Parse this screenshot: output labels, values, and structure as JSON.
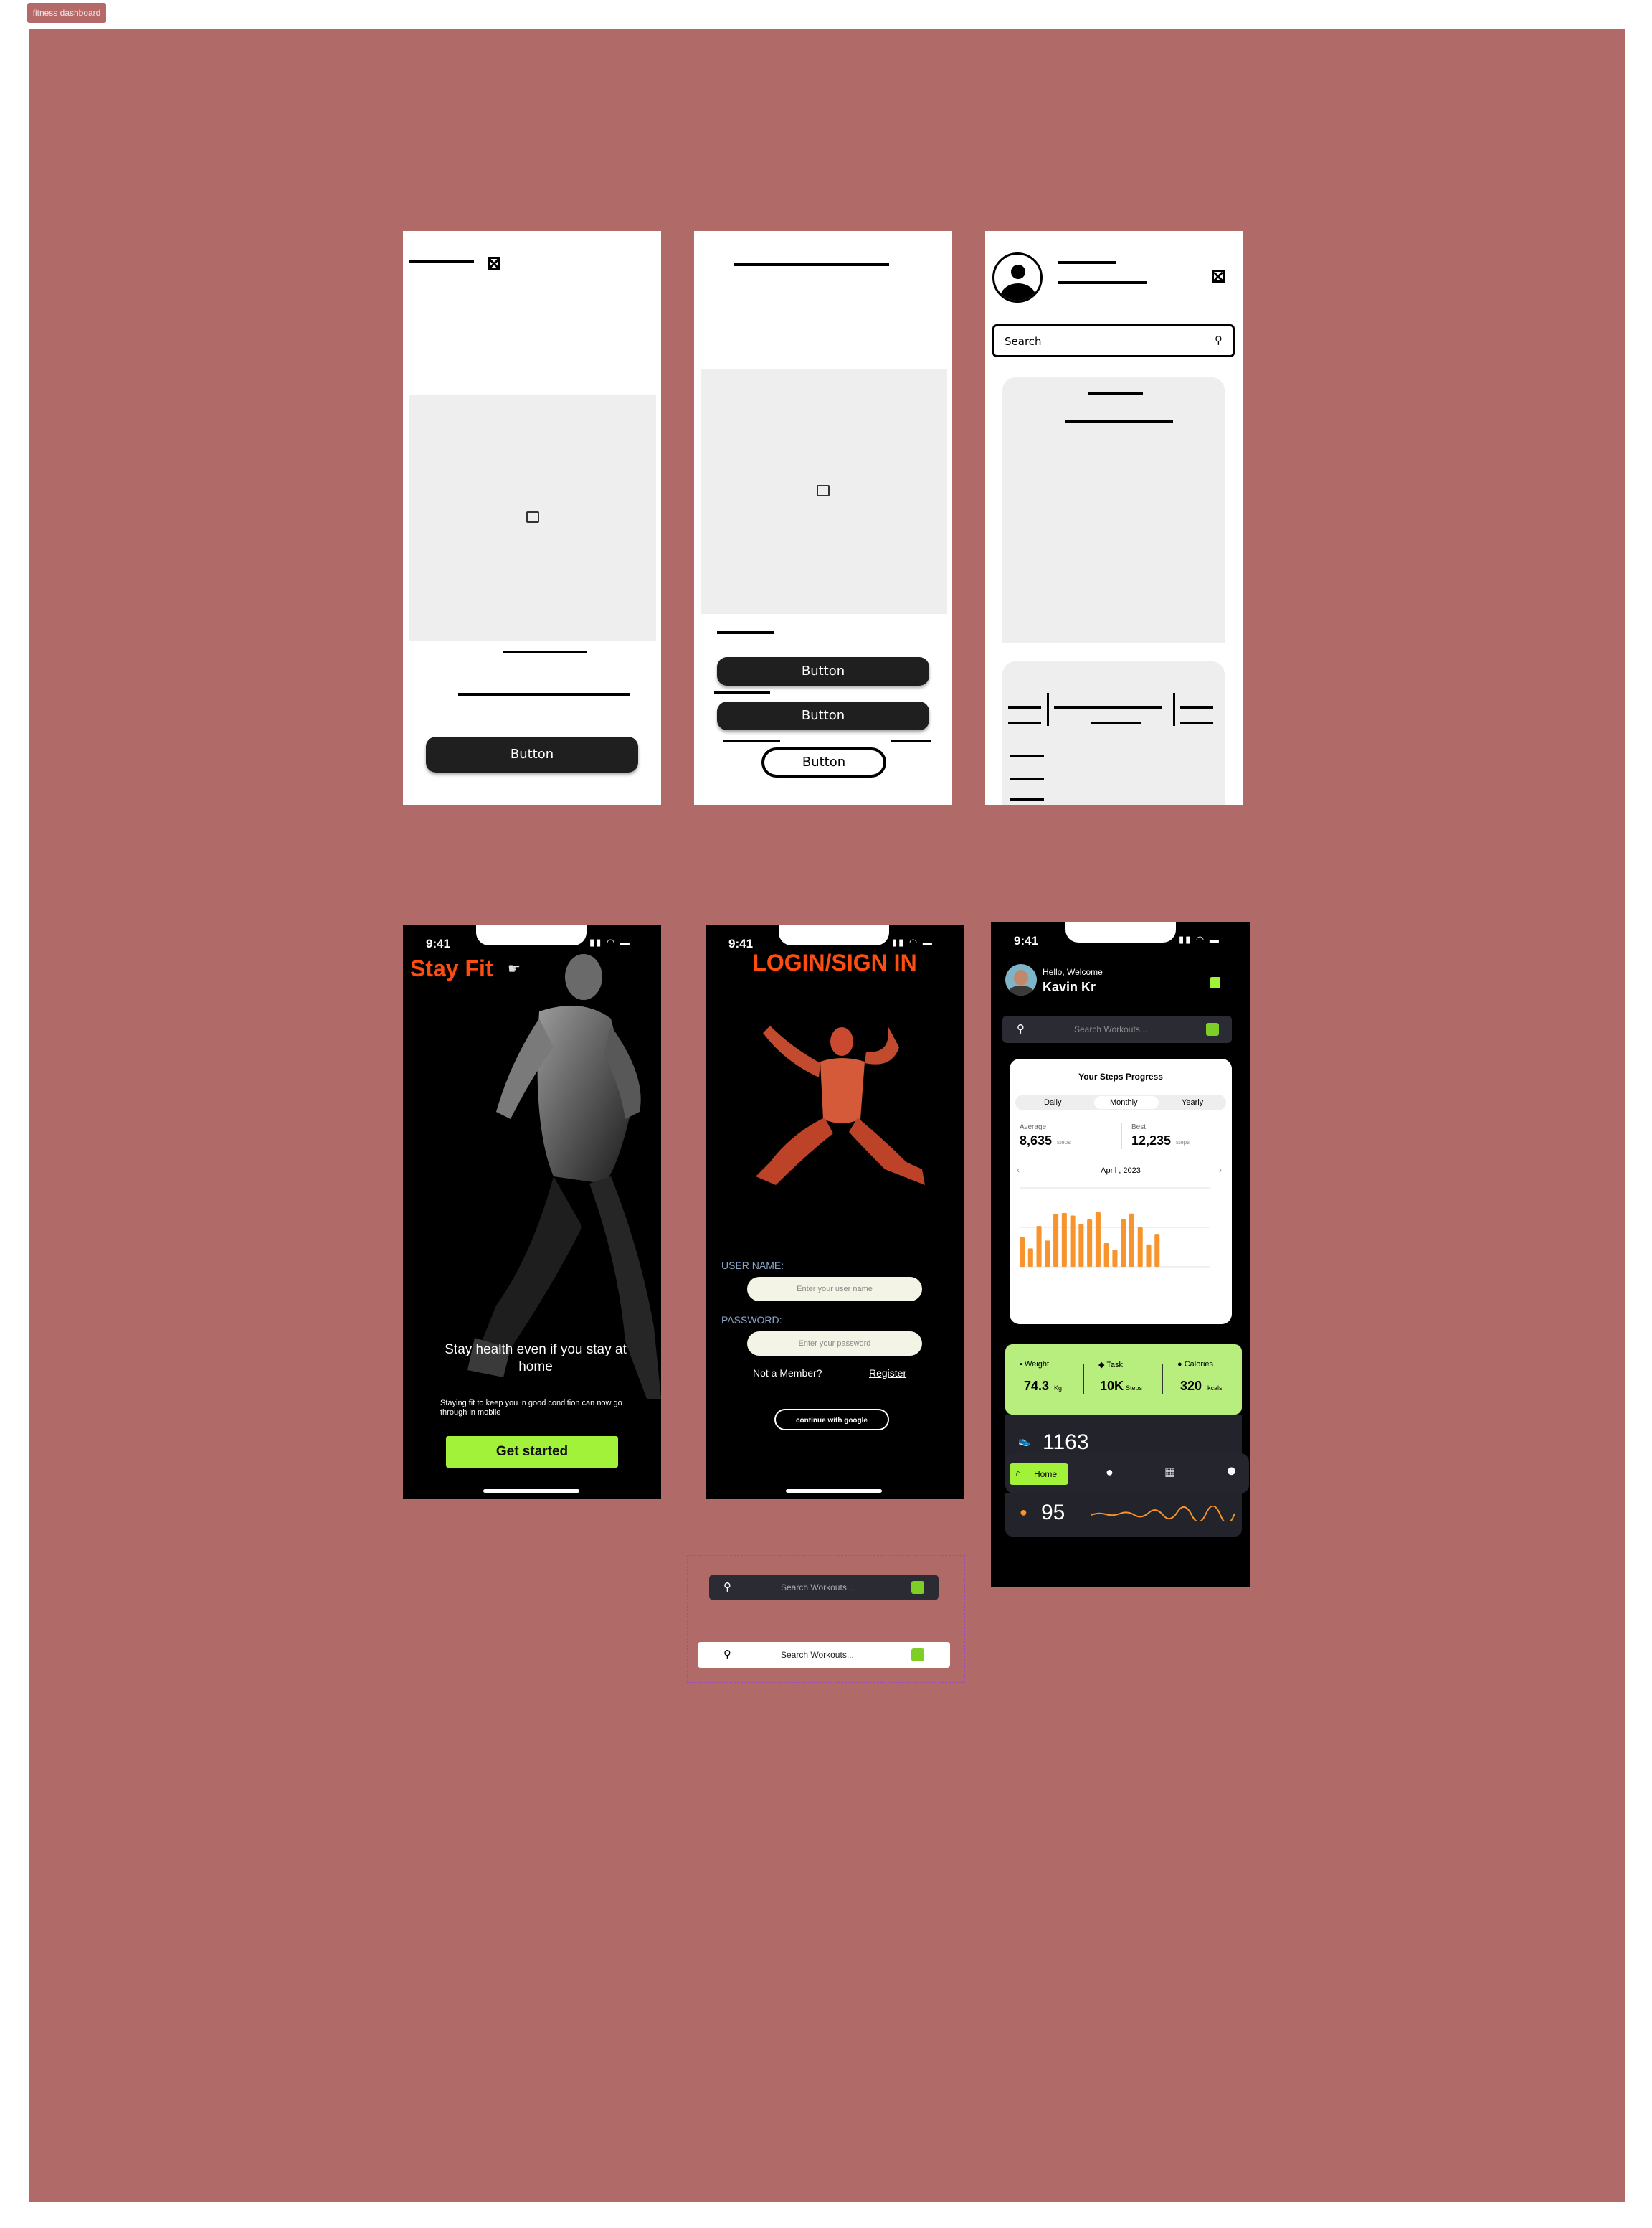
{
  "frame": {
    "label": "fitness dashboard"
  },
  "wireframes": {
    "screen1": {
      "button": "Button"
    },
    "screen2": {
      "buttons": [
        "Button",
        "Button",
        "Button"
      ]
    },
    "screen3": {
      "search": "Search"
    }
  },
  "status": {
    "time": "9:41"
  },
  "onboarding": {
    "title": "Stay Fit",
    "headline": "Stay health even if you stay at home",
    "body": "Staying fit to keep you in good condition can now go through in  mobile",
    "cta": "Get started"
  },
  "login": {
    "title": "LOGIN/SIGN IN",
    "user_label": "USER NAME:",
    "user_placeholder": "Enter your user name",
    "pass_label": "PASSWORD:",
    "pass_placeholder": "Enter your password",
    "not_member": "Not a Member?",
    "register": "Register",
    "google": "continue with google"
  },
  "dashboard": {
    "greeting": "Hello, Welcome",
    "user": "Kavin Kr",
    "search": "Search Workouts...",
    "card_title": "Your Steps Progress",
    "tabs": [
      "Daily",
      "Monthly",
      "Yearly"
    ],
    "average_label": "Average",
    "average_value": "8,635",
    "average_unit": "steps",
    "best_label": "Best",
    "best_value": "12,235",
    "best_unit": "steps",
    "month": "April , 2023",
    "stats": {
      "weight_label": "Weight",
      "weight_value": "74.3",
      "weight_unit": "Kg",
      "task_label": "Task",
      "task_value": "10K",
      "task_unit": "Steps",
      "cal_label": "Calories",
      "cal_value": "320",
      "cal_unit": "kcals"
    },
    "count1": "1163",
    "count2": "95",
    "nav_home": "Home",
    "colors": {
      "accent": "#a3f23a",
      "orange": "#f7942e"
    }
  },
  "chart_data": {
    "type": "bar",
    "values": [
      4500,
      2800,
      6200,
      4000,
      8000,
      8200,
      7800,
      6500,
      7200,
      8300,
      3600,
      2600,
      7200,
      8100,
      6000,
      3400,
      5000
    ],
    "ylim": [
      0,
      12000
    ]
  },
  "search_variants": {
    "dark": "Search Workouts...",
    "light": "Search Workouts..."
  }
}
